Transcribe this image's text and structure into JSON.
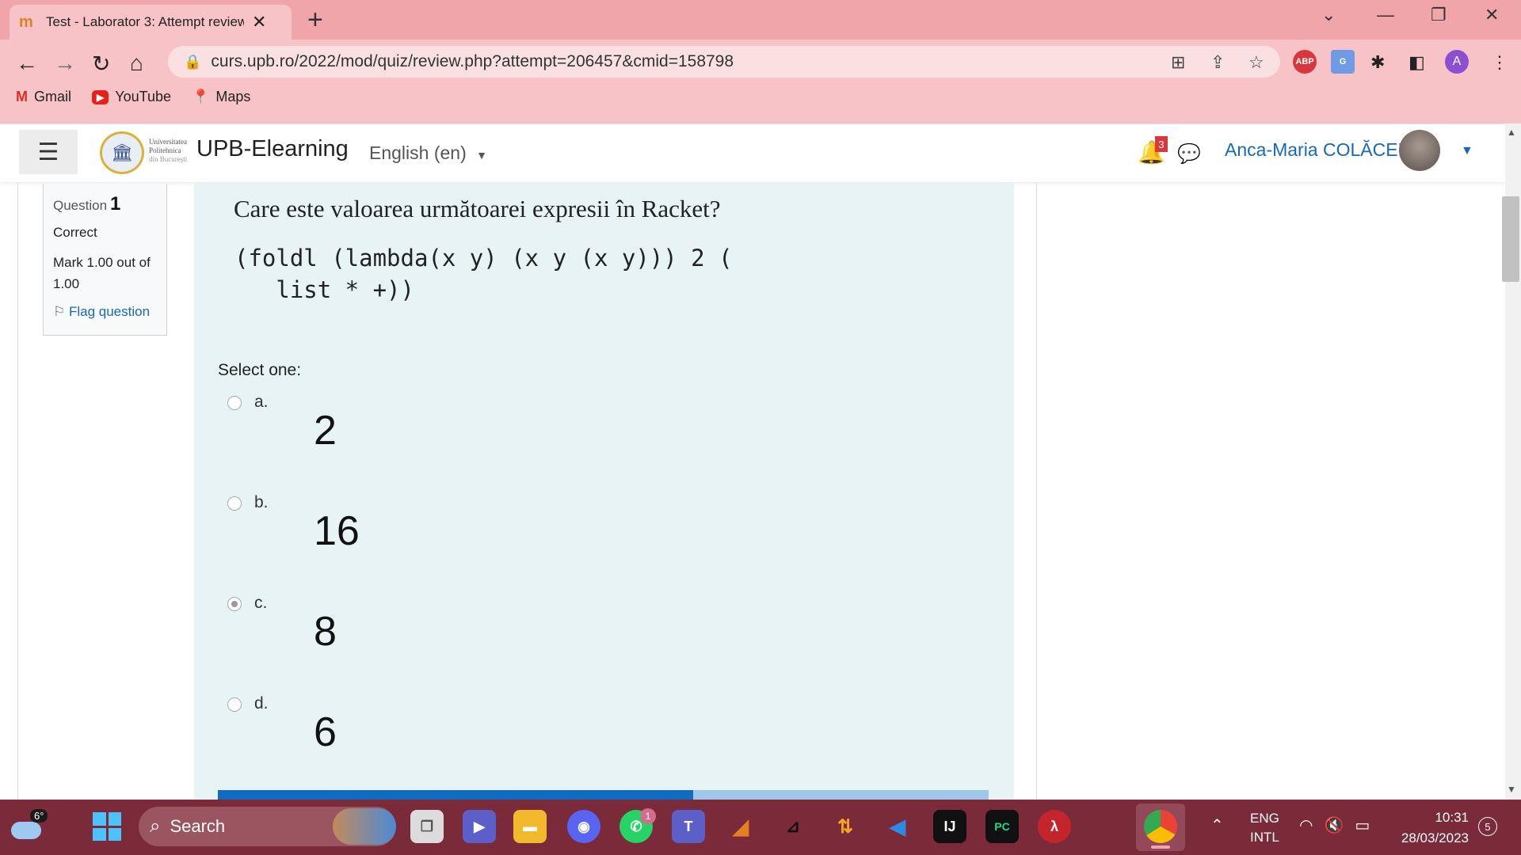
{
  "browser": {
    "tab_title": "Test - Laborator 3: Attempt review",
    "url": "curs.upb.ro/2022/mod/quiz/review.php?attempt=206457&cmid=158798",
    "bookmarks": [
      {
        "label": "Gmail",
        "icon": "gmail-icon"
      },
      {
        "label": "YouTube",
        "icon": "youtube-icon"
      },
      {
        "label": "Maps",
        "icon": "maps-icon"
      }
    ],
    "profile_initial": "A",
    "abp_label": "ABP"
  },
  "header": {
    "logo_text_1": "Universitatea",
    "logo_text_2": "Politehnica",
    "logo_text_3": "din București",
    "site_name": "UPB-Elearning",
    "language": "English (en)",
    "notification_count": "3",
    "user_name": "Anca-Maria COLĂCEL"
  },
  "question_info": {
    "label": "Question",
    "number": "1",
    "state": "Correct",
    "grade": "Mark 1.00 out of 1.00",
    "flag": "Flag question"
  },
  "question": {
    "text": "Care este valoarea următoarei expresii în Racket?",
    "code_line1": "(foldl (lambda(x y) (x y (x y))) 2 (",
    "code_line2": "   list * +))",
    "prompt": "Select one:",
    "options": [
      {
        "letter": "a.",
        "value": "2",
        "selected": false
      },
      {
        "letter": "b.",
        "value": "16",
        "selected": false
      },
      {
        "letter": "c.",
        "value": "8",
        "selected": true
      },
      {
        "letter": "d.",
        "value": "6",
        "selected": false
      }
    ]
  },
  "taskbar": {
    "weather_temp": "6°",
    "search_label": "Search",
    "whatsapp_badge": "1",
    "lang_line1": "ENG",
    "lang_line2": "INTL",
    "time": "10:31",
    "date": "28/03/2023",
    "notification_count": "5"
  }
}
